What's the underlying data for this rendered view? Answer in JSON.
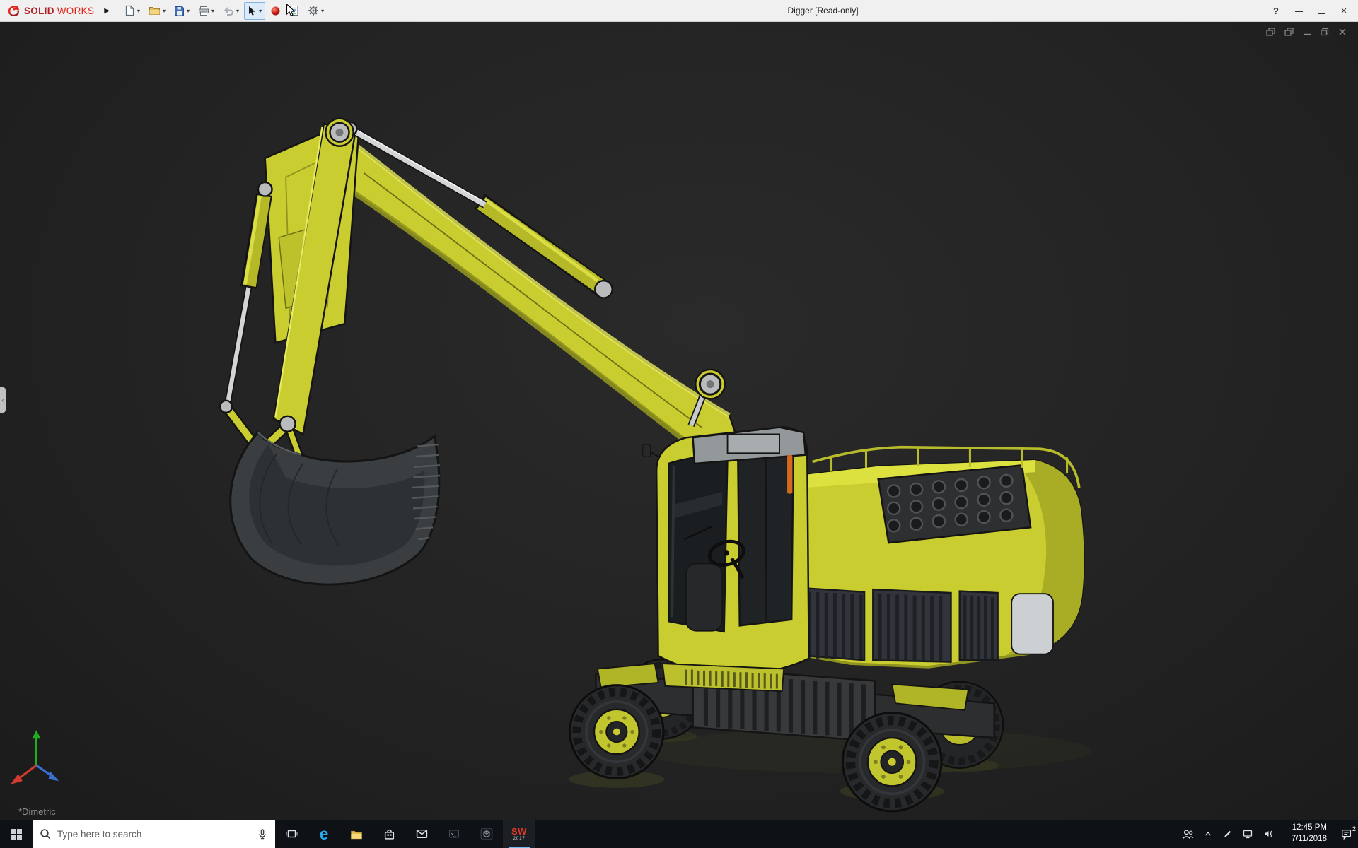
{
  "theme": {
    "titlebar-bg": "#f0f0f0",
    "viewport-bg": "#232323",
    "taskbar-bg": "#0e1116",
    "accent-yellow": "#c9cd2f",
    "brand-red": "#c8202b",
    "save-blue": "#3f6fb6"
  },
  "titlebar": {
    "brand": {
      "primary": "SOLID",
      "secondary": "WORKS",
      "logo_icon": "ds-swirl-icon"
    },
    "expand_arrow": "▶",
    "document_title": "Digger [Read-only]",
    "tools": [
      {
        "id": "new-document",
        "icon": "page-icon",
        "dropdown": true
      },
      {
        "id": "open",
        "icon": "folder-icon",
        "dropdown": true
      },
      {
        "id": "save",
        "icon": "floppy-icon",
        "dropdown": true
      },
      {
        "id": "print",
        "icon": "printer-icon",
        "dropdown": true
      },
      {
        "id": "undo",
        "icon": "undo-arrow-icon",
        "dropdown": true,
        "disabled": true
      },
      {
        "id": "select",
        "icon": "cursor-icon",
        "dropdown": true,
        "active": true
      },
      {
        "id": "appearance",
        "icon": "red-sphere-icon",
        "dropdown": false
      },
      {
        "id": "file-properties",
        "icon": "document-info-icon",
        "dropdown": false
      },
      {
        "id": "options",
        "icon": "gear-icon",
        "dropdown": true
      }
    ],
    "window_controls": {
      "help": "?",
      "close": "×"
    }
  },
  "viewport": {
    "orientation_label": "*Dimetric",
    "doc_controls": [
      "new-window-icon",
      "cascade-icon",
      "minimize-icon",
      "restore-icon",
      "close-icon"
    ],
    "model_name": "excavator-digger",
    "side_tab_glyph": "‹"
  },
  "taskbar": {
    "start": "windows-logo",
    "search": {
      "placeholder": "Type here to search",
      "icons": [
        "search-magnifier-icon",
        "microphone-icon"
      ]
    },
    "pinned_apps": [
      "task-view",
      "edge",
      "file-explorer",
      "store",
      "mail",
      "console",
      "cube-app",
      "solidworks-2017"
    ],
    "edge_glyph": "e",
    "console_glyph": ">_",
    "solidworks_badge": {
      "line1": "SW",
      "line2": "2017"
    },
    "tray": {
      "icons": [
        "people-icon",
        "chevron-up-icon",
        "pen-icon",
        "network-icon",
        "volume-icon"
      ],
      "time": "12:45 PM",
      "date": "7/11/2018",
      "action_center_badge": "2"
    }
  }
}
